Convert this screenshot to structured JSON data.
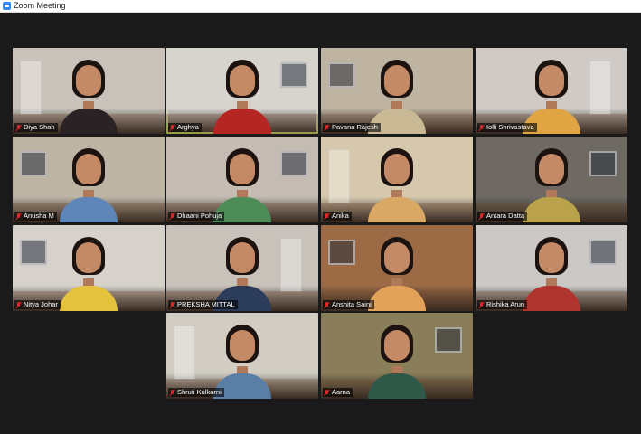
{
  "window": {
    "title": "Zoom Meeting",
    "icon": "zoom-app-icon"
  },
  "gallery": {
    "active_speaker": "Arghya",
    "participants": [
      {
        "name": "Diya Shah",
        "muted": true,
        "wall": "#c9c2bb",
        "top": "#2a2224",
        "active": false
      },
      {
        "name": "Arghya",
        "muted": true,
        "wall": "#d7d3cd",
        "top": "#b42524",
        "active": true
      },
      {
        "name": "Pavana Rajesh",
        "muted": true,
        "wall": "#bfb3a1",
        "top": "#c9ba95",
        "active": false
      },
      {
        "name": "Iolli Shrivastava",
        "muted": true,
        "wall": "#cfcac5",
        "top": "#e0a542",
        "active": false
      },
      {
        "name": "Anusha M",
        "muted": true,
        "wall": "#bdb4a4",
        "top": "#5f86b8",
        "active": false
      },
      {
        "name": "Dhaani Pohuja",
        "muted": true,
        "wall": "#c4bbb2",
        "top": "#4e8c57",
        "active": false
      },
      {
        "name": "Anika",
        "muted": true,
        "wall": "#d6c8ad",
        "top": "#d8a864",
        "active": false
      },
      {
        "name": "Antara Datta",
        "muted": true,
        "wall": "#6e6a63",
        "top": "#b9a24a",
        "active": false
      },
      {
        "name": "Nitya Johar",
        "muted": true,
        "wall": "#d6d1ca",
        "top": "#e5c23e",
        "active": false
      },
      {
        "name": "PREKSHA MITTAL",
        "muted": true,
        "wall": "#c8c2bb",
        "top": "#2c3d5c",
        "active": false
      },
      {
        "name": "Anshita Saini",
        "muted": true,
        "wall": "#9c6a45",
        "top": "#e3a25a",
        "active": false
      },
      {
        "name": "Rishika Arun",
        "muted": true,
        "wall": "#cbc8c6",
        "top": "#b1352f",
        "active": false
      },
      {
        "name": "Shruti Kulkarni",
        "muted": true,
        "wall": "#d1cdc3",
        "top": "#5a7fa6",
        "active": false
      },
      {
        "name": "Aarna",
        "muted": true,
        "wall": "#8a7d5a",
        "top": "#2e5848",
        "active": false
      }
    ]
  }
}
